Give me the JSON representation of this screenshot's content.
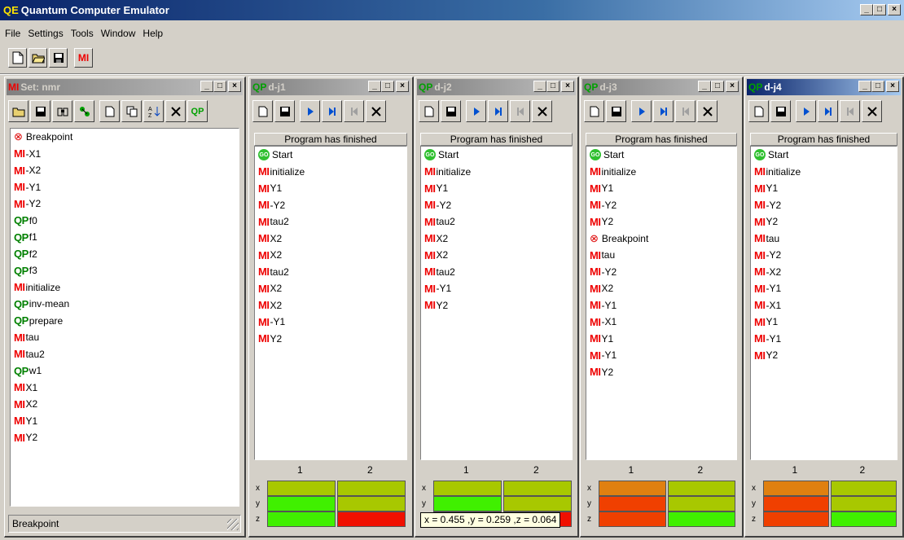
{
  "app": {
    "logo": "QE",
    "title": "Quantum Computer Emulator",
    "window_controls": [
      "_",
      "□",
      "×"
    ]
  },
  "menu": [
    "File",
    "Settings",
    "Tools",
    "Window",
    "Help"
  ],
  "toolbar": {
    "mi_label": "MI"
  },
  "set_window": {
    "logo": "MI",
    "title": "Set: nmr",
    "qp_button": "QP",
    "items": [
      {
        "type": "bp",
        "label": "Breakpoint"
      },
      {
        "type": "MI",
        "label": "-X1"
      },
      {
        "type": "MI",
        "label": "-X2"
      },
      {
        "type": "MI",
        "label": "-Y1"
      },
      {
        "type": "MI",
        "label": "-Y2"
      },
      {
        "type": "QP",
        "label": "f0"
      },
      {
        "type": "QP",
        "label": "f1"
      },
      {
        "type": "QP",
        "label": "f2"
      },
      {
        "type": "QP",
        "label": "f3"
      },
      {
        "type": "MI",
        "label": "initialize"
      },
      {
        "type": "QP",
        "label": "inv-mean"
      },
      {
        "type": "QP",
        "label": "prepare"
      },
      {
        "type": "MI",
        "label": "tau"
      },
      {
        "type": "MI",
        "label": "tau2"
      },
      {
        "type": "QP",
        "label": "w1"
      },
      {
        "type": "MI",
        "label": "X1"
      },
      {
        "type": "MI",
        "label": "X2"
      },
      {
        "type": "MI",
        "label": "Y1"
      },
      {
        "type": "MI",
        "label": "Y2"
      }
    ],
    "status": "Breakpoint"
  },
  "program_windows": [
    {
      "logo": "QP",
      "title": "d-j1",
      "active": false,
      "status": "Program has finished",
      "items": [
        {
          "type": "go",
          "label": "Start"
        },
        {
          "type": "MI",
          "label": "initialize"
        },
        {
          "type": "MI",
          "label": "Y1"
        },
        {
          "type": "MI",
          "label": "-Y2"
        },
        {
          "type": "MI",
          "label": "tau2"
        },
        {
          "type": "MI",
          "label": "X2"
        },
        {
          "type": "MI",
          "label": "X2"
        },
        {
          "type": "MI",
          "label": "tau2"
        },
        {
          "type": "MI",
          "label": "X2"
        },
        {
          "type": "MI",
          "label": "X2"
        },
        {
          "type": "MI",
          "label": "-Y1"
        },
        {
          "type": "MI",
          "label": "Y2"
        }
      ],
      "bloch": {
        "columns": [
          "1",
          "2"
        ],
        "rows": [
          "x",
          "y",
          "z"
        ],
        "colors": [
          [
            "#a8c800",
            "#a8c800"
          ],
          [
            "#40f000",
            "#a8c800"
          ],
          [
            "#40f000",
            "#f01000"
          ]
        ]
      }
    },
    {
      "logo": "QP",
      "title": "d-j2",
      "active": false,
      "status": "Program has finished",
      "items": [
        {
          "type": "go",
          "label": "Start"
        },
        {
          "type": "MI",
          "label": "initialize"
        },
        {
          "type": "MI",
          "label": "Y1"
        },
        {
          "type": "MI",
          "label": "-Y2"
        },
        {
          "type": "MI",
          "label": "tau2"
        },
        {
          "type": "MI",
          "label": "X2"
        },
        {
          "type": "MI",
          "label": "X2"
        },
        {
          "type": "MI",
          "label": "tau2"
        },
        {
          "type": "MI",
          "label": "-Y1"
        },
        {
          "type": "MI",
          "label": "Y2"
        }
      ],
      "bloch": {
        "columns": [
          "1",
          "2"
        ],
        "rows": [
          "x",
          "y",
          "z"
        ],
        "colors": [
          [
            "#a8c800",
            "#a8c800"
          ],
          [
            "#40f000",
            "#a8c800"
          ],
          [
            "#40f000",
            "#f01000"
          ]
        ]
      }
    },
    {
      "logo": "QP",
      "title": "d-j3",
      "active": false,
      "status": "Program has finished",
      "items": [
        {
          "type": "go",
          "label": "Start"
        },
        {
          "type": "MI",
          "label": "initialize"
        },
        {
          "type": "MI",
          "label": "Y1"
        },
        {
          "type": "MI",
          "label": "-Y2"
        },
        {
          "type": "MI",
          "label": "Y2"
        },
        {
          "type": "bp",
          "label": "Breakpoint"
        },
        {
          "type": "MI",
          "label": "tau"
        },
        {
          "type": "MI",
          "label": "-Y2"
        },
        {
          "type": "MI",
          "label": "X2"
        },
        {
          "type": "MI",
          "label": "-Y1"
        },
        {
          "type": "MI",
          "label": "-X1"
        },
        {
          "type": "MI",
          "label": "Y1"
        },
        {
          "type": "MI",
          "label": "-Y1"
        },
        {
          "type": "MI",
          "label": "Y2"
        }
      ],
      "bloch": {
        "columns": [
          "1",
          "2"
        ],
        "rows": [
          "x",
          "y",
          "z"
        ],
        "colors": [
          [
            "#e08010",
            "#a8c800"
          ],
          [
            "#f04000",
            "#a8c800"
          ],
          [
            "#f04000",
            "#40f000"
          ]
        ]
      }
    },
    {
      "logo": "QP",
      "title": "d-j4",
      "active": true,
      "status": "Program has finished",
      "items": [
        {
          "type": "go",
          "label": "Start"
        },
        {
          "type": "MI",
          "label": "initialize"
        },
        {
          "type": "MI",
          "label": "Y1"
        },
        {
          "type": "MI",
          "label": "-Y2"
        },
        {
          "type": "MI",
          "label": "Y2"
        },
        {
          "type": "MI",
          "label": "tau"
        },
        {
          "type": "MI",
          "label": "-Y2"
        },
        {
          "type": "MI",
          "label": "-X2"
        },
        {
          "type": "MI",
          "label": "-Y1"
        },
        {
          "type": "MI",
          "label": "-X1"
        },
        {
          "type": "MI",
          "label": "Y1"
        },
        {
          "type": "MI",
          "label": "-Y1"
        },
        {
          "type": "MI",
          "label": "Y2"
        }
      ],
      "bloch": {
        "columns": [
          "1",
          "2"
        ],
        "rows": [
          "x",
          "y",
          "z"
        ],
        "colors": [
          [
            "#e08010",
            "#a8c800"
          ],
          [
            "#f04000",
            "#a8c800"
          ],
          [
            "#f04000",
            "#40f000"
          ]
        ]
      }
    }
  ],
  "tooltip": "x = 0.455 ,y = 0.259 ,z = 0.064",
  "go_label": "GO",
  "bp_icon": "⊗"
}
